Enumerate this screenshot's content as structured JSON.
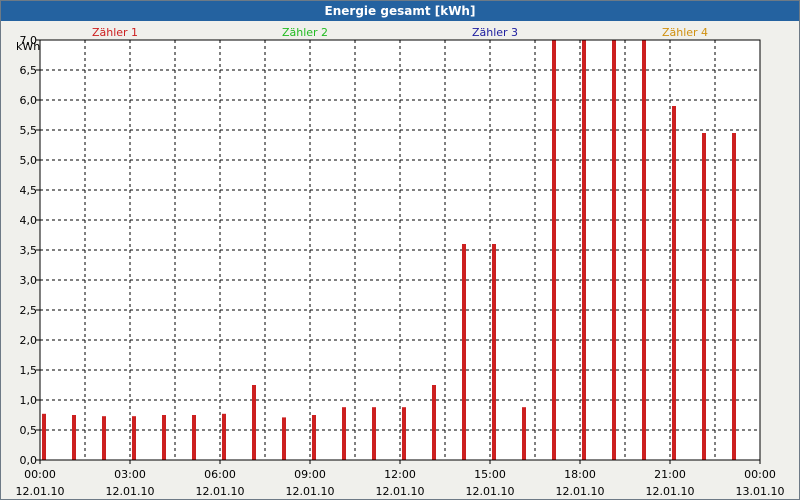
{
  "header": {
    "title": "Energie gesamt [kWh]"
  },
  "chart_data": {
    "type": "bar",
    "title": "Energie gesamt [kWh]",
    "ylabel": "kWh",
    "xlabel": "",
    "ylim": [
      0,
      7.0
    ],
    "grid": true,
    "legend_position": "top",
    "legend": [
      {
        "name": "Zähler 1",
        "color": "#cc2020"
      },
      {
        "name": "Zähler 2",
        "color": "#22bb22"
      },
      {
        "name": "Zähler 3",
        "color": "#2020a0"
      },
      {
        "name": "Zähler 4",
        "color": "#d09010"
      }
    ],
    "y_ticks": [
      "0,0",
      "0,5",
      "1,0",
      "1,5",
      "2,0",
      "2,5",
      "3,0",
      "3,5",
      "4,0",
      "4,5",
      "5,0",
      "5,5",
      "6,0",
      "6,5",
      "7,0"
    ],
    "x_ticks": [
      {
        "time": "00:00",
        "date": "12.01.10"
      },
      {
        "time": "03:00",
        "date": "12.01.10"
      },
      {
        "time": "06:00",
        "date": "12.01.10"
      },
      {
        "time": "09:00",
        "date": "12.01.10"
      },
      {
        "time": "12:00",
        "date": "12.01.10"
      },
      {
        "time": "15:00",
        "date": "12.01.10"
      },
      {
        "time": "18:00",
        "date": "12.01.10"
      },
      {
        "time": "21:00",
        "date": "12.01.10"
      },
      {
        "time": "00:00",
        "date": "13.01.10"
      }
    ],
    "series": [
      {
        "color": "#cc2020",
        "x": [
          "00:00",
          "01:00",
          "02:00",
          "03:00",
          "04:00",
          "05:00",
          "06:00",
          "07:00",
          "08:00",
          "09:00",
          "10:00",
          "11:00",
          "12:00",
          "13:00",
          "14:00",
          "15:00",
          "16:00",
          "17:00",
          "18:00",
          "19:00",
          "20:00",
          "21:00",
          "22:00",
          "23:00"
        ],
        "values": [
          0.77,
          0.75,
          0.73,
          0.73,
          0.75,
          0.75,
          0.77,
          1.25,
          0.71,
          0.75,
          0.88,
          0.88,
          0.88,
          1.25,
          3.6,
          3.6,
          0.88,
          7.0,
          7.0,
          7.0,
          7.0,
          5.9,
          5.45,
          5.45
        ]
      }
    ]
  }
}
